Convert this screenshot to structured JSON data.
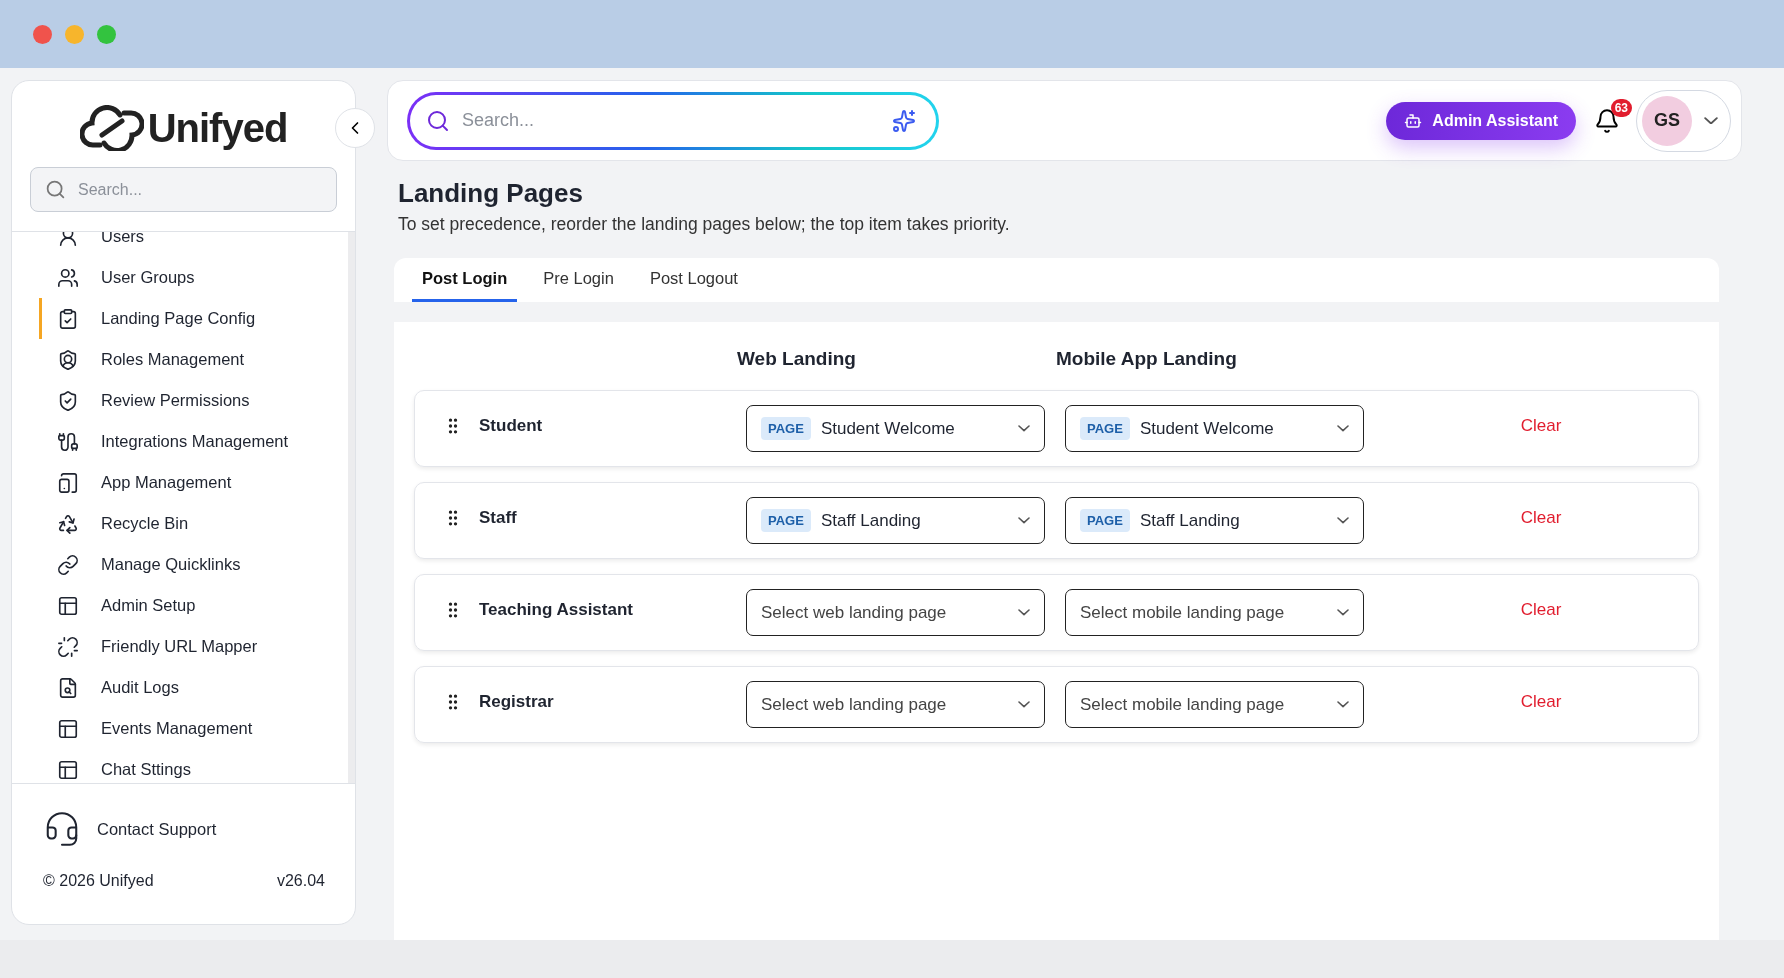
{
  "sidebar": {
    "logo": "Unifyed",
    "search": {
      "placeholder": "Search..."
    },
    "items": [
      {
        "label": "Users",
        "selected": false
      },
      {
        "label": "User Groups",
        "selected": false
      },
      {
        "label": "Landing Page Config",
        "selected": true
      },
      {
        "label": "Roles Management",
        "selected": false
      },
      {
        "label": "Review Permissions",
        "selected": false
      },
      {
        "label": "Integrations Management",
        "selected": false
      },
      {
        "label": "App Management",
        "selected": false
      },
      {
        "label": "Recycle Bin",
        "selected": false
      },
      {
        "label": "Manage Quicklinks",
        "selected": false
      },
      {
        "label": "Admin Setup",
        "selected": false
      },
      {
        "label": "Friendly URL Mapper",
        "selected": false
      },
      {
        "label": "Audit Logs",
        "selected": false
      },
      {
        "label": "Events Management",
        "selected": false
      },
      {
        "label": "Chat Sttings",
        "selected": false
      }
    ],
    "support": "Contact Support",
    "copyright": "© 2026 Unifyed",
    "version": "v26.04"
  },
  "header": {
    "search": {
      "placeholder": "Search..."
    },
    "assistant_button": "Admin Assistant",
    "notifications": "63",
    "avatar": "GS"
  },
  "page": {
    "title": "Landing Pages",
    "subtitle": "To set precedence, reorder the landing pages below; the top item takes priority."
  },
  "tabs": [
    {
      "label": "Post Login",
      "selected": true
    },
    {
      "label": "Pre Login",
      "selected": false
    },
    {
      "label": "Post Logout",
      "selected": false
    }
  ],
  "table": {
    "columns": [
      "Web Landing",
      "Mobile App Landing"
    ],
    "rows": [
      {
        "name": "Student",
        "web": {
          "tag": "PAGE",
          "value": "Student Welcome"
        },
        "mobile": {
          "tag": "PAGE",
          "value": "Student Welcome"
        },
        "action": "Clear"
      },
      {
        "name": "Staff",
        "web": {
          "tag": "PAGE",
          "value": "Staff Landing"
        },
        "mobile": {
          "tag": "PAGE",
          "value": "Staff Landing"
        },
        "action": "Clear"
      },
      {
        "name": "Teaching Assistant",
        "web": {
          "placeholder": "Select web landing page"
        },
        "mobile": {
          "placeholder": "Select mobile landing page"
        },
        "action": "Clear"
      },
      {
        "name": "Registrar",
        "web": {
          "placeholder": "Select web landing page"
        },
        "mobile": {
          "placeholder": "Select mobile landing page"
        },
        "action": "Clear"
      }
    ]
  }
}
